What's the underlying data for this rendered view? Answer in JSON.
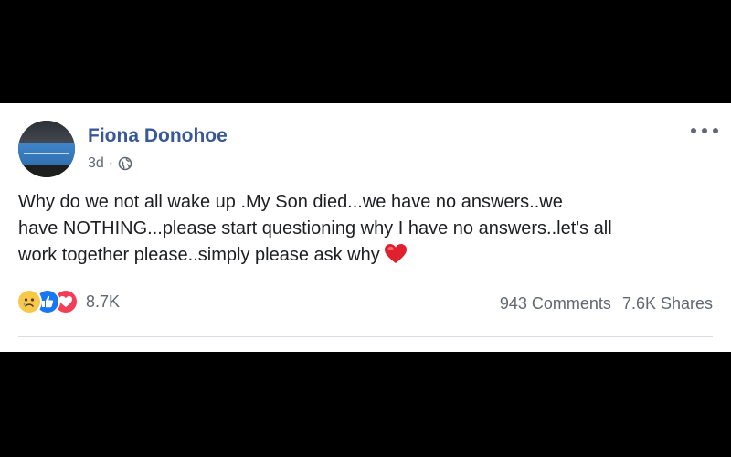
{
  "post": {
    "author": "Fiona Donohoe",
    "timestamp": "3d",
    "separator": "·",
    "privacy_icon": "globe-icon",
    "text_lines": [
      "Why do we not all wake up .My Son died...we have no answers..we",
      "have NOTHING...please start questioning why I have no answers..let's all",
      "work together please..simply please ask why"
    ],
    "trailing_emoji": "red-heart",
    "more_icon": "ellipsis-icon"
  },
  "reactions": {
    "icons": [
      "sad",
      "like",
      "love"
    ],
    "count": "8.7K"
  },
  "engagement": {
    "comments": "943 Comments",
    "shares": "7.6K Shares"
  },
  "colors": {
    "author_name": "#385898",
    "secondary_text": "#606770",
    "like_blue": "#1877f2",
    "love_red": "#f33e58",
    "sad_yellow": "#f7c84a"
  }
}
